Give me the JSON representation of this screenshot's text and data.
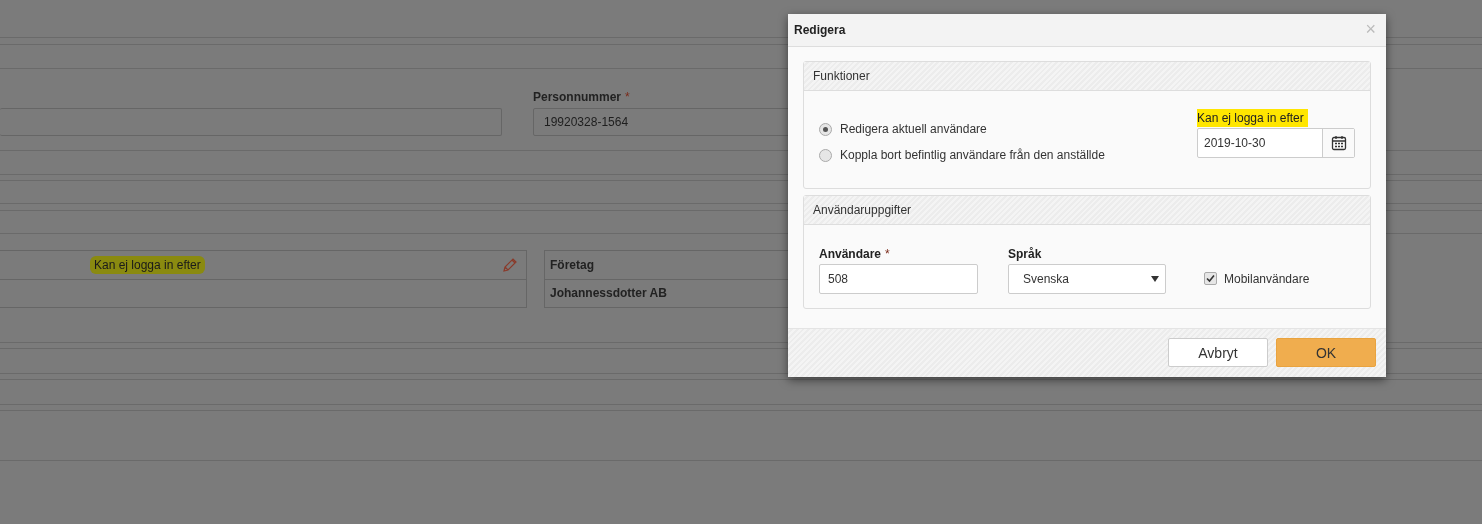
{
  "background": {
    "personnummer": {
      "label": "Personnummer",
      "required_mark": "*",
      "value": "19920328-1564"
    },
    "left_panel": {
      "header": "Kan ej logga in efter",
      "highlighted": true
    },
    "right_panel": {
      "header": "Företag",
      "value": "Johannessdotter AB"
    }
  },
  "dialog": {
    "title": "Redigera",
    "close": "×",
    "functions": {
      "title": "Funktioner",
      "radios": [
        {
          "label": "Redigera aktuell användare",
          "selected": true
        },
        {
          "label": "Koppla bort befintlig användare från den anställde",
          "selected": false
        }
      ],
      "date": {
        "label": "Kan ej logga in efter",
        "highlighted": true,
        "value": "2019-10-30"
      }
    },
    "user_details": {
      "title": "Användaruppgifter",
      "user": {
        "label": "Användare",
        "required_mark": "*",
        "value": "508"
      },
      "language": {
        "label": "Språk",
        "value": "Svenska"
      },
      "mobile": {
        "label": "Mobilanvändare",
        "checked": true
      }
    },
    "buttons": [
      {
        "label": "Avbryt",
        "kind": "default"
      },
      {
        "label": "OK",
        "kind": "primary"
      }
    ]
  }
}
